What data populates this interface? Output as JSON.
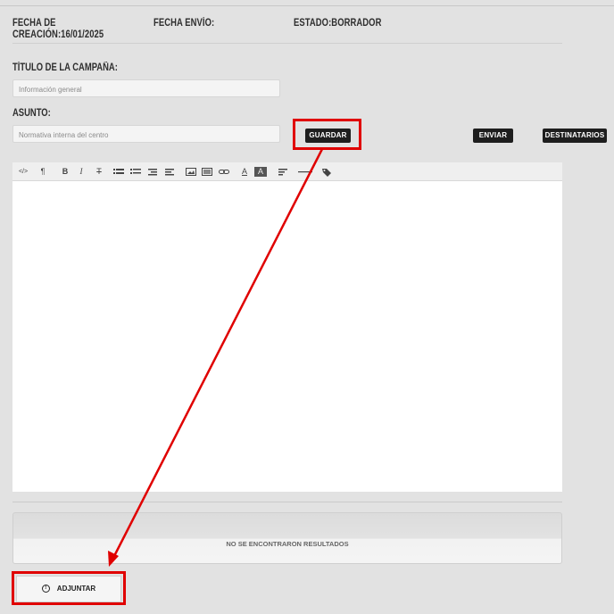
{
  "header": {
    "creation_label": "FECHA DE",
    "creation_value": "CREACIÓN:16/01/2025",
    "send_label": "FECHA ENVÍO:",
    "state_label": "ESTADO:BORRADOR"
  },
  "campaign": {
    "title_label": "TÍTULO DE LA CAMPAÑA:",
    "title_value": "Información general",
    "subject_label": "ASUNTO:",
    "subject_value": "Normativa interna del centro"
  },
  "buttons": {
    "save": "GUARDAR",
    "send": "ENVIAR",
    "recipients": "DESTINATARIOS",
    "attach": "ADJUNTAR"
  },
  "toolbar": {
    "html": "</>",
    "paragraph": "¶",
    "bold": "B",
    "italic": "I",
    "strike": "T",
    "font_color": "A",
    "font_bg": "A"
  },
  "results": {
    "empty_text": "NO SE ENCONTRARON RESULTADOS"
  },
  "colors": {
    "annotation": "#e00000",
    "button_dark": "#1e1e1e"
  }
}
